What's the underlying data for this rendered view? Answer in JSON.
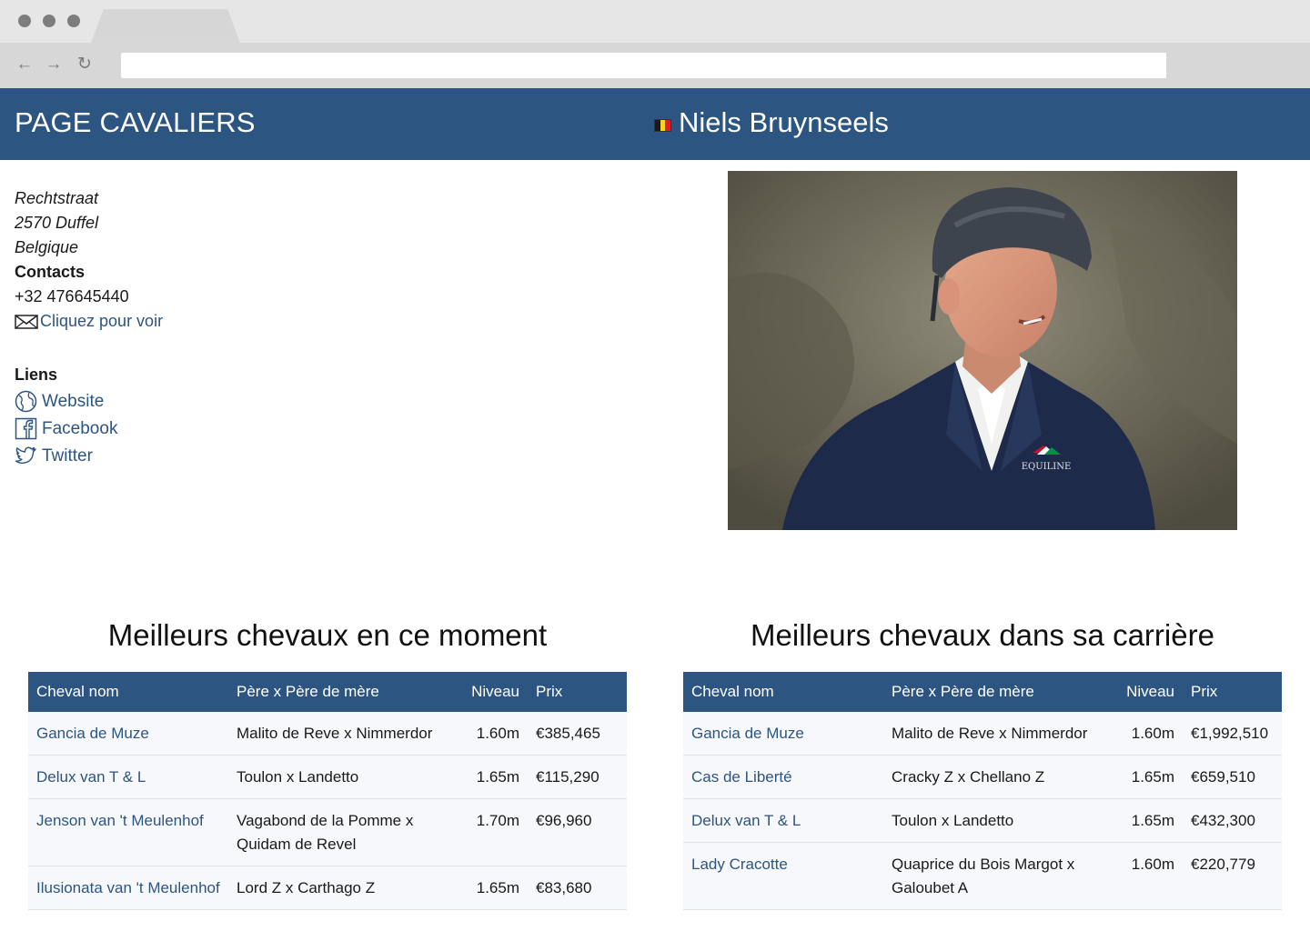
{
  "header": {
    "title": "PAGE CAVALIERS",
    "rider_name": "Niels Bruynseels",
    "flag_colors": [
      "#1a1a1a",
      "#f7d415",
      "#e31b23"
    ],
    "brand_color": "#2d5582"
  },
  "contact": {
    "street": "Rechtstraat",
    "city": "2570 Duffel",
    "country": "Belgique",
    "contacts_label": "Contacts",
    "phone": "+32 476645440",
    "email_link": "Cliquez pour voir"
  },
  "links": {
    "title": "Liens",
    "website": "Website",
    "facebook": "Facebook",
    "twitter": "Twitter"
  },
  "photo": {
    "jacket_logo": "EQUILINE"
  },
  "tables": {
    "current": {
      "title": "Meilleurs chevaux en ce moment",
      "headers": [
        "Cheval nom",
        "Père x Père de mère",
        "Niveau",
        "Prix"
      ],
      "rows": [
        [
          "Gancia de Muze",
          "Malito de Reve x Nimmerdor",
          "1.60m",
          "€385,465"
        ],
        [
          "Delux van T & L",
          "Toulon x Landetto",
          "1.65m",
          "€115,290"
        ],
        [
          "Jenson van 't Meulenhof",
          "Vagabond de la Pomme x Quidam de Revel",
          "1.70m",
          "€96,960"
        ],
        [
          "Ilusionata van 't Meulenhof",
          "Lord Z x Carthago Z",
          "1.65m",
          "€83,680"
        ]
      ]
    },
    "career": {
      "title": "Meilleurs chevaux dans sa carrière",
      "headers": [
        "Cheval nom",
        "Père x Père de mère",
        "Niveau",
        "Prix"
      ],
      "rows": [
        [
          "Gancia de Muze",
          "Malito de Reve x Nimmerdor",
          "1.60m",
          "€1,992,510"
        ],
        [
          "Cas de Liberté",
          "Cracky Z x Chellano Z",
          "1.65m",
          "€659,510"
        ],
        [
          "Delux van T & L",
          "Toulon x Landetto",
          "1.65m",
          "€432,300"
        ],
        [
          "Lady Cracotte",
          "Quaprice du Bois Margot x Galoubet A",
          "1.60m",
          "€220,779"
        ]
      ]
    }
  }
}
